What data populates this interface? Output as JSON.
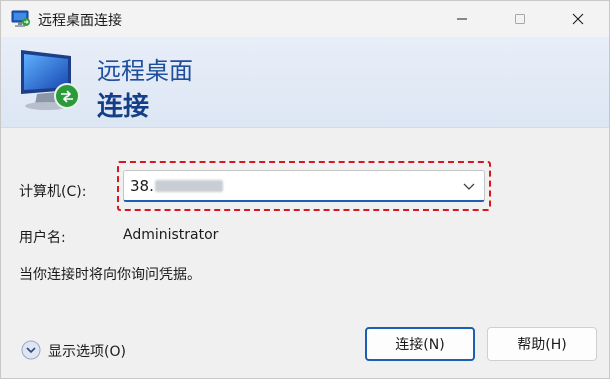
{
  "window": {
    "title": "远程桌面连接"
  },
  "banner": {
    "line1": "远程桌面",
    "line2": "连接"
  },
  "form": {
    "computer_label": "计算机(C):",
    "computer_value_prefix": "38.",
    "username_label": "用户名:",
    "username_value": "Administrator",
    "credentials_note": "当你连接时将向你询问凭据。"
  },
  "footer": {
    "show_options_label": "显示选项(O)",
    "connect_label": "连接(N)",
    "help_label": "帮助(H)"
  },
  "icons": {
    "app": "remote-desktop-icon",
    "minimize": "minimize-icon",
    "maximize": "maximize-icon",
    "close": "close-icon",
    "dropdown": "chevron-down-icon",
    "options": "expand-options-icon"
  },
  "colors": {
    "accent": "#1a5fb4",
    "banner_text": "#1e4f9c",
    "highlight_border": "#d8161f"
  }
}
